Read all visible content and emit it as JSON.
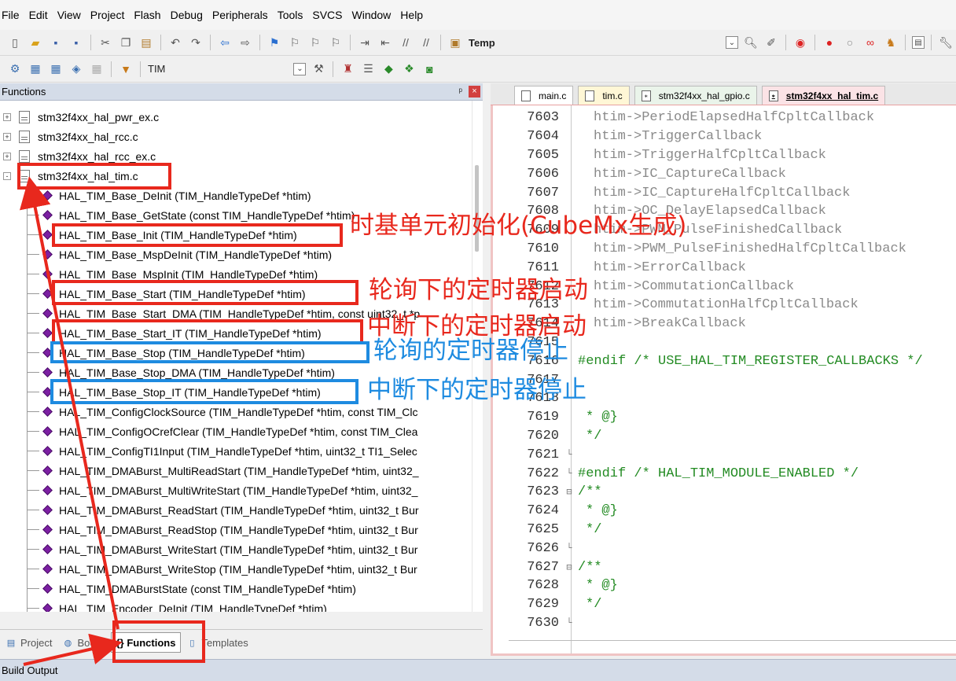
{
  "menu": [
    "File",
    "Edit",
    "View",
    "Project",
    "Flash",
    "Debug",
    "Peripherals",
    "Tools",
    "SVCS",
    "Window",
    "Help"
  ],
  "toolbar1": {
    "target_label": "Temp"
  },
  "toolbar2": {
    "target_label": "TIM"
  },
  "functions_panel": {
    "title": "Functions",
    "pin_icon": "pin-icon",
    "close_icon": "close-icon",
    "files": [
      {
        "label": "stm32f4xx_hal_pwr_ex.c",
        "expander": "+"
      },
      {
        "label": "stm32f4xx_hal_rcc.c",
        "expander": "+"
      },
      {
        "label": "stm32f4xx_hal_rcc_ex.c",
        "expander": "+"
      },
      {
        "label": "stm32f4xx_hal_tim.c",
        "expander": "-"
      }
    ],
    "functions": [
      "HAL_TIM_Base_DeInit (TIM_HandleTypeDef *htim)",
      "HAL_TIM_Base_GetState (const TIM_HandleTypeDef *htim)",
      "HAL_TIM_Base_Init (TIM_HandleTypeDef *htim)",
      "HAL_TIM_Base_MspDeInit (TIM_HandleTypeDef *htim)",
      "HAL_TIM_Base_MspInit (TIM_HandleTypeDef *htim)",
      "HAL_TIM_Base_Start (TIM_HandleTypeDef *htim)",
      "HAL_TIM_Base_Start_DMA (TIM_HandleTypeDef *htim, const uint32_t *p",
      "HAL_TIM_Base_Start_IT (TIM_HandleTypeDef *htim)",
      "HAL_TIM_Base_Stop (TIM_HandleTypeDef *htim)",
      "HAL_TIM_Base_Stop_DMA (TIM_HandleTypeDef *htim)",
      "HAL_TIM_Base_Stop_IT (TIM_HandleTypeDef *htim)",
      "HAL_TIM_ConfigClockSource (TIM_HandleTypeDef *htim, const TIM_Clc",
      "HAL_TIM_ConfigOCrefClear (TIM_HandleTypeDef *htim, const TIM_Clea",
      "HAL_TIM_ConfigTI1Input (TIM_HandleTypeDef *htim, uint32_t TI1_Selec",
      "HAL_TIM_DMABurst_MultiReadStart (TIM_HandleTypeDef *htim, uint32_",
      "HAL_TIM_DMABurst_MultiWriteStart (TIM_HandleTypeDef *htim, uint32_",
      "HAL_TIM_DMABurst_ReadStart (TIM_HandleTypeDef *htim, uint32_t Bur",
      "HAL_TIM_DMABurst_ReadStop (TIM_HandleTypeDef *htim, uint32_t Bur",
      "HAL_TIM_DMABurst_WriteStart (TIM_HandleTypeDef *htim, uint32_t Bur",
      "HAL_TIM_DMABurst_WriteStop (TIM_HandleTypeDef *htim, uint32_t Bur",
      "HAL_TIM_DMABurstState (const TIM_HandleTypeDef *htim)",
      "HAL_TIM_Encoder_DeInit (TIM_HandleTypeDef *htim)"
    ],
    "tabs": [
      {
        "label": "Project",
        "icon": "project-icon"
      },
      {
        "label": "Books",
        "icon": "books-icon"
      },
      {
        "label": "{} Functions",
        "icon": "functions-icon"
      },
      {
        "label": "Templates",
        "icon": "templates-icon"
      }
    ]
  },
  "build_output": {
    "title": "Build Output"
  },
  "editor": {
    "tabs": [
      "main.c",
      "tim.c",
      "stm32f4xx_hal_gpio.c",
      "stm32f4xx_hal_tim.c"
    ],
    "lines": [
      {
        "n": "7603",
        "fold": "",
        "text": "htim->PeriodElapsedHalfCpltCallback",
        "style": "gray",
        "indent": 2
      },
      {
        "n": "7604",
        "fold": "",
        "text": "htim->TriggerCallback",
        "style": "gray",
        "indent": 2
      },
      {
        "n": "7605",
        "fold": "",
        "text": "htim->TriggerHalfCpltCallback",
        "style": "gray",
        "indent": 2
      },
      {
        "n": "7606",
        "fold": "",
        "text": "htim->IC_CaptureCallback",
        "style": "gray",
        "indent": 2
      },
      {
        "n": "7607",
        "fold": "",
        "text": "htim->IC_CaptureHalfCpltCallback",
        "style": "gray",
        "indent": 2
      },
      {
        "n": "7608",
        "fold": "",
        "text": "htim->OC_DelayElapsedCallback",
        "style": "gray",
        "indent": 2
      },
      {
        "n": "7609",
        "fold": "",
        "text": "htim->PWM_PulseFinishedCallback",
        "style": "gray",
        "indent": 2
      },
      {
        "n": "7610",
        "fold": "",
        "text": "htim->PWM_PulseFinishedHalfCpltCallback",
        "style": "gray",
        "indent": 2
      },
      {
        "n": "7611",
        "fold": "",
        "text": "htim->ErrorCallback",
        "style": "gray",
        "indent": 2
      },
      {
        "n": "7612",
        "fold": "",
        "text": "htim->CommutationCallback",
        "style": "gray",
        "indent": 2
      },
      {
        "n": "7613",
        "fold": "",
        "text": "htim->CommutationHalfCpltCallback",
        "style": "gray",
        "indent": 2
      },
      {
        "n": "7614",
        "fold": "",
        "text": "htim->BreakCallback",
        "style": "gray",
        "indent": 2
      },
      {
        "n": "7615",
        "fold": "",
        "text": "",
        "style": "gray",
        "indent": 0
      },
      {
        "n": "7616",
        "fold": "",
        "text": "#endif /* USE_HAL_TIM_REGISTER_CALLBACKS */",
        "style": "green",
        "indent": 0
      },
      {
        "n": "7617",
        "fold": "",
        "text": "",
        "style": "gray",
        "indent": 0
      },
      {
        "n": "7618",
        "fold": "",
        "text": "",
        "style": "gray",
        "indent": 0
      },
      {
        "n": "7619",
        "fold": "",
        "text": "* @}",
        "style": "green",
        "indent": 1
      },
      {
        "n": "7620",
        "fold": "",
        "text": "*/",
        "style": "green",
        "indent": 1
      },
      {
        "n": "7621",
        "fold": "└",
        "text": "",
        "style": "gray",
        "indent": 0
      },
      {
        "n": "7622",
        "fold": "└",
        "text": "#endif /* HAL_TIM_MODULE_ENABLED */",
        "style": "green",
        "indent": 0
      },
      {
        "n": "7623",
        "fold": "⊟",
        "text": "/**",
        "style": "green",
        "indent": 0
      },
      {
        "n": "7624",
        "fold": "",
        "text": "* @}",
        "style": "green",
        "indent": 1
      },
      {
        "n": "7625",
        "fold": "",
        "text": "*/",
        "style": "green",
        "indent": 1
      },
      {
        "n": "7626",
        "fold": "└",
        "text": "",
        "style": "gray",
        "indent": 0
      },
      {
        "n": "7627",
        "fold": "⊟",
        "text": "/**",
        "style": "green",
        "indent": 0
      },
      {
        "n": "7628",
        "fold": "",
        "text": "* @}",
        "style": "green",
        "indent": 1
      },
      {
        "n": "7629",
        "fold": "",
        "text": "*/",
        "style": "green",
        "indent": 1
      },
      {
        "n": "7630",
        "fold": "└",
        "text": "",
        "style": "gray",
        "indent": 0
      }
    ]
  },
  "annotations": {
    "base_init": "时基单元初始化(CubeMx生成)",
    "base_start": "轮询下的定时器启动",
    "base_start_it": "中断下的定时器启动",
    "base_stop": "轮询的定时器停止",
    "base_stop_it": "中断下的定时器停止",
    "color_red": "#e8281d",
    "color_blue": "#1e8be0"
  }
}
